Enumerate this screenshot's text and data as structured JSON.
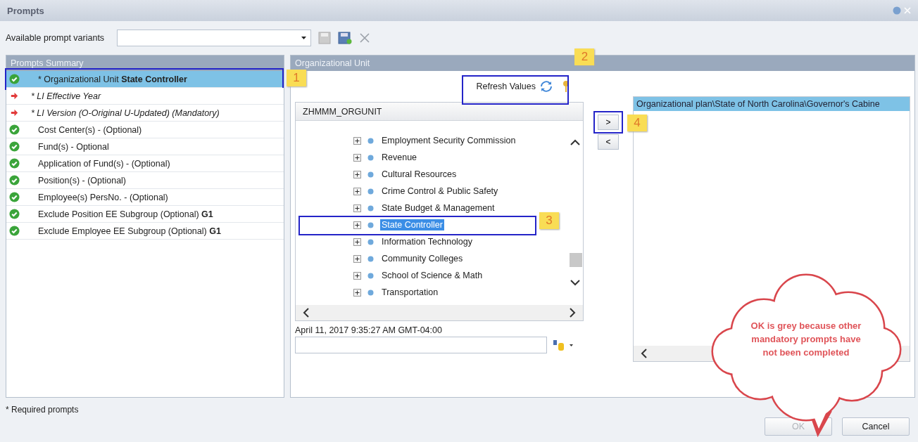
{
  "window": {
    "title": "Prompts"
  },
  "toolbar": {
    "label": "Available prompt variants"
  },
  "summary": {
    "title": "Prompts Summary",
    "rows": [
      {
        "kind": "done",
        "text": "* Organizational Unit **State Controller**",
        "selected": true,
        "callout": "1"
      },
      {
        "kind": "required",
        "text": "* LI Effective Year",
        "selected": false
      },
      {
        "kind": "required",
        "text": "* LI Version (O-Original U-Updated) (Mandatory)",
        "selected": false
      },
      {
        "kind": "done",
        "text": "Cost Center(s) - (Optional)",
        "selected": false
      },
      {
        "kind": "done",
        "text": "Fund(s) - Optional",
        "selected": false
      },
      {
        "kind": "done",
        "text": "Application of Fund(s) - (Optional)",
        "selected": false
      },
      {
        "kind": "done",
        "text": "Position(s) - (Optional)",
        "selected": false
      },
      {
        "kind": "done",
        "text": "Employee(s) PersNo. - (Optional)",
        "selected": false
      },
      {
        "kind": "done",
        "text": "Exclude Position EE Subgroup (Optional) **G1**",
        "selected": false
      },
      {
        "kind": "done",
        "text": "Exclude Employee EE Subgroup (Optional) **G1**",
        "selected": false
      }
    ]
  },
  "org_unit": {
    "title": "Organizational Unit",
    "refresh": {
      "label": "Refresh Values",
      "callout": "2"
    },
    "tree": {
      "column": "ZHMMM_ORGUNIT",
      "items": [
        {
          "label": "Employment Security Commission",
          "selected": false
        },
        {
          "label": "Revenue",
          "selected": false
        },
        {
          "label": "Cultural Resources",
          "selected": false
        },
        {
          "label": "Crime Control & Public Safety",
          "selected": false
        },
        {
          "label": "State Budget & Management",
          "selected": false
        },
        {
          "label": "State Controller",
          "selected": true,
          "callout": "3"
        },
        {
          "label": "Information Technology",
          "selected": false
        },
        {
          "label": "Community Colleges",
          "selected": false
        },
        {
          "label": "School of Science & Math",
          "selected": false
        },
        {
          "label": "Transportation",
          "selected": false
        }
      ]
    },
    "date": "April 11, 2017 9:35:27 AM GMT-04:00",
    "transfer_buttons": [
      {
        "label": ">",
        "callout": "4"
      },
      {
        "label": "<"
      }
    ],
    "selected_values": [
      {
        "text": "Organizational plan\\State of North Carolina\\Governor's Cabine",
        "selected": true
      }
    ]
  },
  "footnote": "* Required prompts",
  "buttons": [
    {
      "label": "OK",
      "disabled": true
    },
    {
      "label": "Cancel",
      "disabled": false
    }
  ],
  "note": {
    "text": "OK is grey because other mandatory prompts have not been completed"
  }
}
